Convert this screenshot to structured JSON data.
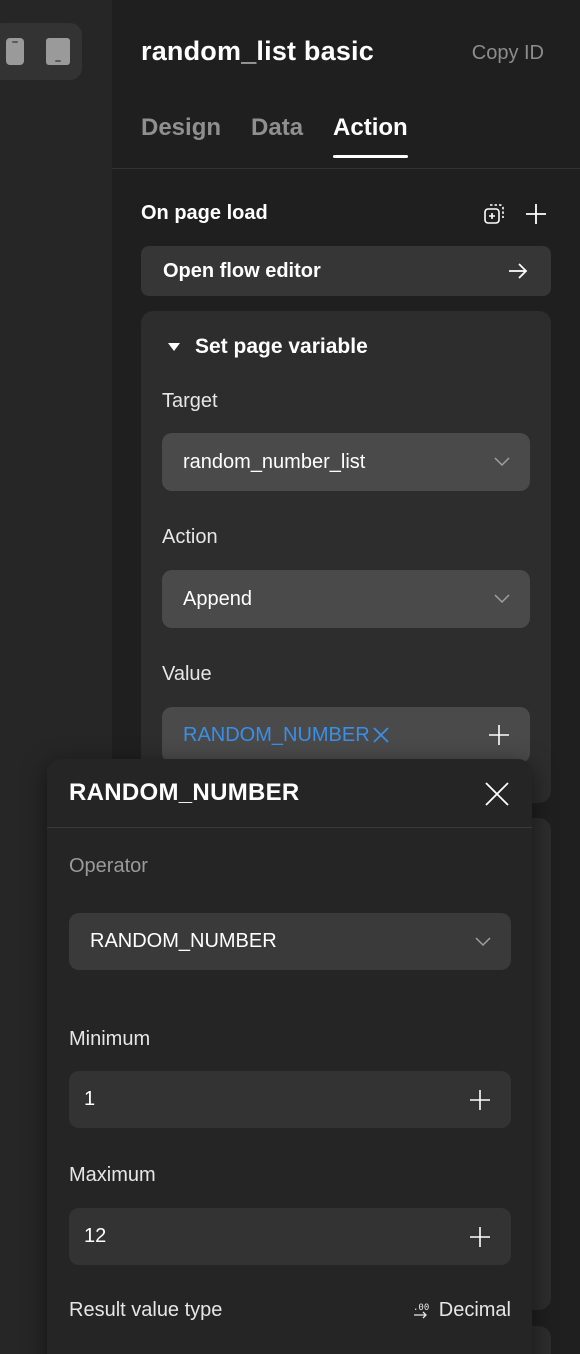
{
  "header": {
    "title": "random_list basic",
    "copy_id_label": "Copy ID"
  },
  "tabs": [
    {
      "label": "Design",
      "active": false
    },
    {
      "label": "Data",
      "active": false
    },
    {
      "label": "Action",
      "active": true
    }
  ],
  "on_page_load": {
    "label": "On page load",
    "open_flow_editor_label": "Open flow editor"
  },
  "action_card": {
    "title": "Set page variable",
    "target_label": "Target",
    "target_value": "random_number_list",
    "action_label": "Action",
    "action_value": "Append",
    "value_label": "Value",
    "value_token": "RANDOM_NUMBER"
  },
  "popover": {
    "title": "RANDOM_NUMBER",
    "operator_label": "Operator",
    "operator_value": "RANDOM_NUMBER",
    "minimum_label": "Minimum",
    "minimum_value": "1",
    "maximum_label": "Maximum",
    "maximum_value": "12",
    "result_type_label": "Result value type",
    "result_type_value": "Decimal"
  },
  "colors": {
    "token_blue": "#3b8fe6",
    "panel_bg": "#1f1f1f",
    "card_bg": "#2d2d2d"
  },
  "icons": {
    "device_phone": "phone-icon",
    "device_tablet": "tablet-icon",
    "duplicate": "duplicate-icon",
    "add": "plus-icon",
    "arrow": "arrow-right-icon",
    "caret": "caret-down-icon",
    "chevron": "chevron-down-icon",
    "remove": "x-icon",
    "close": "close-icon",
    "decimal": "decimal-icon"
  }
}
